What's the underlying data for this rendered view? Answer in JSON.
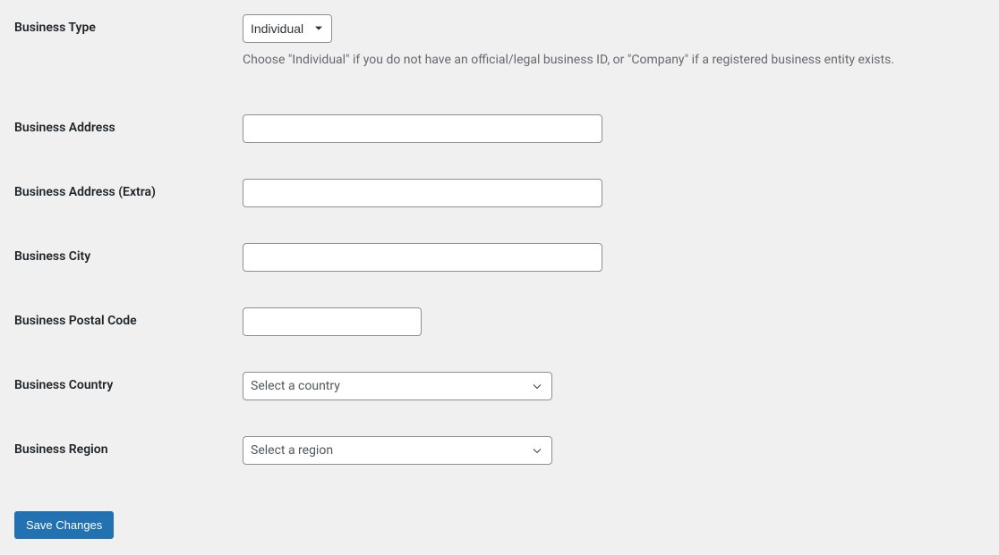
{
  "fields": {
    "business_type": {
      "label": "Business Type",
      "value": "Individual",
      "help": "Choose \"Individual\" if you do not have an official/legal business ID, or \"Company\" if a registered business entity exists."
    },
    "business_address": {
      "label": "Business Address",
      "value": ""
    },
    "business_address_extra": {
      "label": "Business Address (Extra)",
      "value": ""
    },
    "business_city": {
      "label": "Business City",
      "value": ""
    },
    "business_postal_code": {
      "label": "Business Postal Code",
      "value": ""
    },
    "business_country": {
      "label": "Business Country",
      "placeholder": "Select a country"
    },
    "business_region": {
      "label": "Business Region",
      "placeholder": "Select a region"
    }
  },
  "actions": {
    "save": "Save Changes"
  }
}
